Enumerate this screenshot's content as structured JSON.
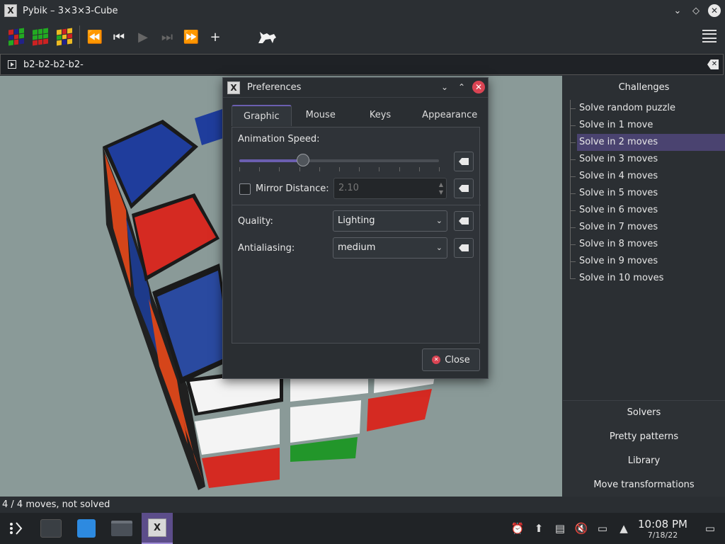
{
  "window": {
    "title": "Pybik – 3×3×3-Cube",
    "app_icon": "X"
  },
  "toolbar": {
    "buttons": [
      {
        "name": "new-solved-cube-icon"
      },
      {
        "name": "new-random-cube-icon"
      },
      {
        "name": "reset-cube-icon"
      },
      {
        "name": "rewind-icon",
        "glyph": "⏪"
      },
      {
        "name": "previous-icon",
        "glyph": "⏮"
      },
      {
        "name": "play-icon",
        "glyph": "▶"
      },
      {
        "name": "next-icon",
        "glyph": "⏭"
      },
      {
        "name": "forward-icon",
        "glyph": "⏩"
      },
      {
        "name": "add-mark-icon",
        "glyph": "+"
      }
    ]
  },
  "command": {
    "value": "b2-b2-b2-b2-"
  },
  "sidebar": {
    "header": "Challenges",
    "items": [
      "Solve random puzzle",
      "Solve in 1 move",
      "Solve in 2 moves",
      "Solve in 3 moves",
      "Solve in 4 moves",
      "Solve in 5 moves",
      "Solve in 6 moves",
      "Solve in 7 moves",
      "Solve in 8 moves",
      "Solve in 9 moves",
      "Solve in 10 moves"
    ],
    "selected_index": 2,
    "bottom": [
      "Solvers",
      "Pretty patterns",
      "Library",
      "Move transformations"
    ]
  },
  "status": "4 / 4 moves, not solved",
  "preferences": {
    "title": "Preferences",
    "tabs": [
      "Graphic",
      "Mouse",
      "Keys",
      "Appearance"
    ],
    "active_tab": 0,
    "animation_speed_label": "Animation Speed:",
    "animation_speed_fraction": 0.32,
    "mirror_distance_label": "Mirror Distance:",
    "mirror_distance_value": "2.10",
    "mirror_checked": false,
    "quality_label": "Quality:",
    "quality_value": "Lighting",
    "antialiasing_label": "Antialiasing:",
    "antialiasing_value": "medium",
    "close_label": "Close"
  },
  "taskbar": {
    "time": "10:08 PM",
    "date": "7/18/22"
  },
  "colors": {
    "accent": "#6b5fb0",
    "selection": "#4a4370",
    "close": "#da4453",
    "viewport_bg": "#8a9a98"
  }
}
